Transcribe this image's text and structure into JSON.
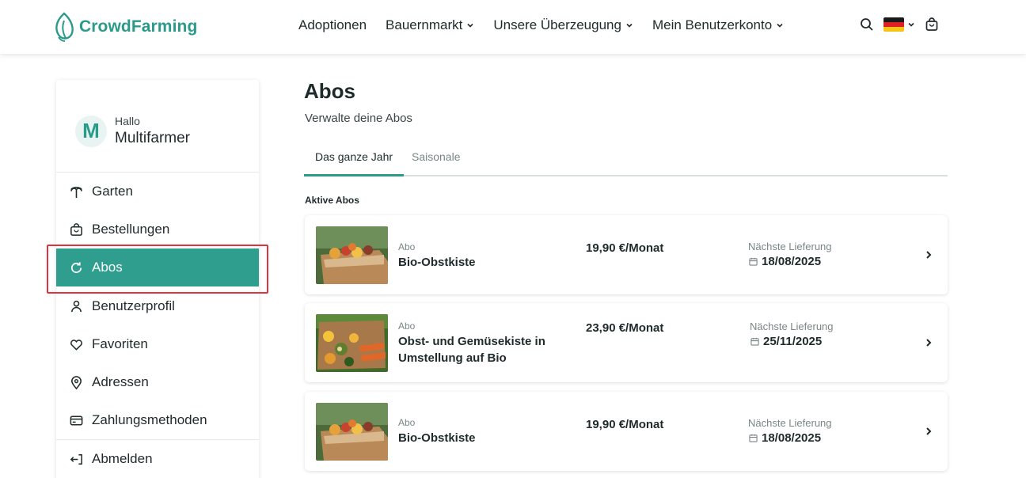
{
  "header": {
    "brand": "CrowdFarming",
    "nav": [
      {
        "label": "Adoptionen",
        "has_dropdown": false
      },
      {
        "label": "Bauernmarkt",
        "has_dropdown": true
      },
      {
        "label": "Unsere Überzeugung",
        "has_dropdown": true
      },
      {
        "label": "Mein Benutzerkonto",
        "has_dropdown": true
      }
    ],
    "icons": [
      "search-icon",
      "germany-flag-icon",
      "chevron-down-icon",
      "shopping-bag-icon"
    ]
  },
  "sidebar": {
    "avatar_initial": "M",
    "greeting": "Hallo",
    "user_name": "Multifarmer",
    "items": [
      {
        "label": "Garten",
        "icon": "palm-tree-icon",
        "active": false
      },
      {
        "label": "Bestellungen",
        "icon": "bag-icon",
        "active": false
      },
      {
        "label": "Abos",
        "icon": "refresh-icon",
        "active": true
      },
      {
        "label": "Benutzerprofil",
        "icon": "user-icon",
        "active": false
      },
      {
        "label": "Favoriten",
        "icon": "heart-icon",
        "active": false
      },
      {
        "label": "Adressen",
        "icon": "location-pin-icon",
        "active": false
      },
      {
        "label": "Zahlungsmethoden",
        "icon": "credit-card-icon",
        "active": false
      }
    ],
    "logout_label": "Abmelden"
  },
  "main": {
    "title": "Abos",
    "subtitle": "Verwalte deine Abos",
    "tabs": [
      {
        "label": "Das ganze Jahr",
        "active": true
      },
      {
        "label": "Saisonale",
        "active": false
      }
    ],
    "section_title": "Aktive Abos",
    "subscriptions": [
      {
        "kind": "Abo",
        "name": "Bio-Obstkiste",
        "price": "19,90 €/Monat",
        "next_label": "Nächste Lieferung",
        "next_date": "18/08/2025"
      },
      {
        "kind": "Abo",
        "name": "Obst- und Gemüsekiste in Umstellung auf Bio",
        "price": "23,90 €/Monat",
        "next_label": "Nächste Lieferung",
        "next_date": "25/11/2025"
      },
      {
        "kind": "Abo",
        "name": "Bio-Obstkiste",
        "price": "19,90 €/Monat",
        "next_label": "Nächste Lieferung",
        "next_date": "18/08/2025"
      }
    ]
  },
  "colors": {
    "brand": "#2a9a8a",
    "active_menu": "#2f9e8e",
    "highlight_outline": "#e0333c"
  }
}
